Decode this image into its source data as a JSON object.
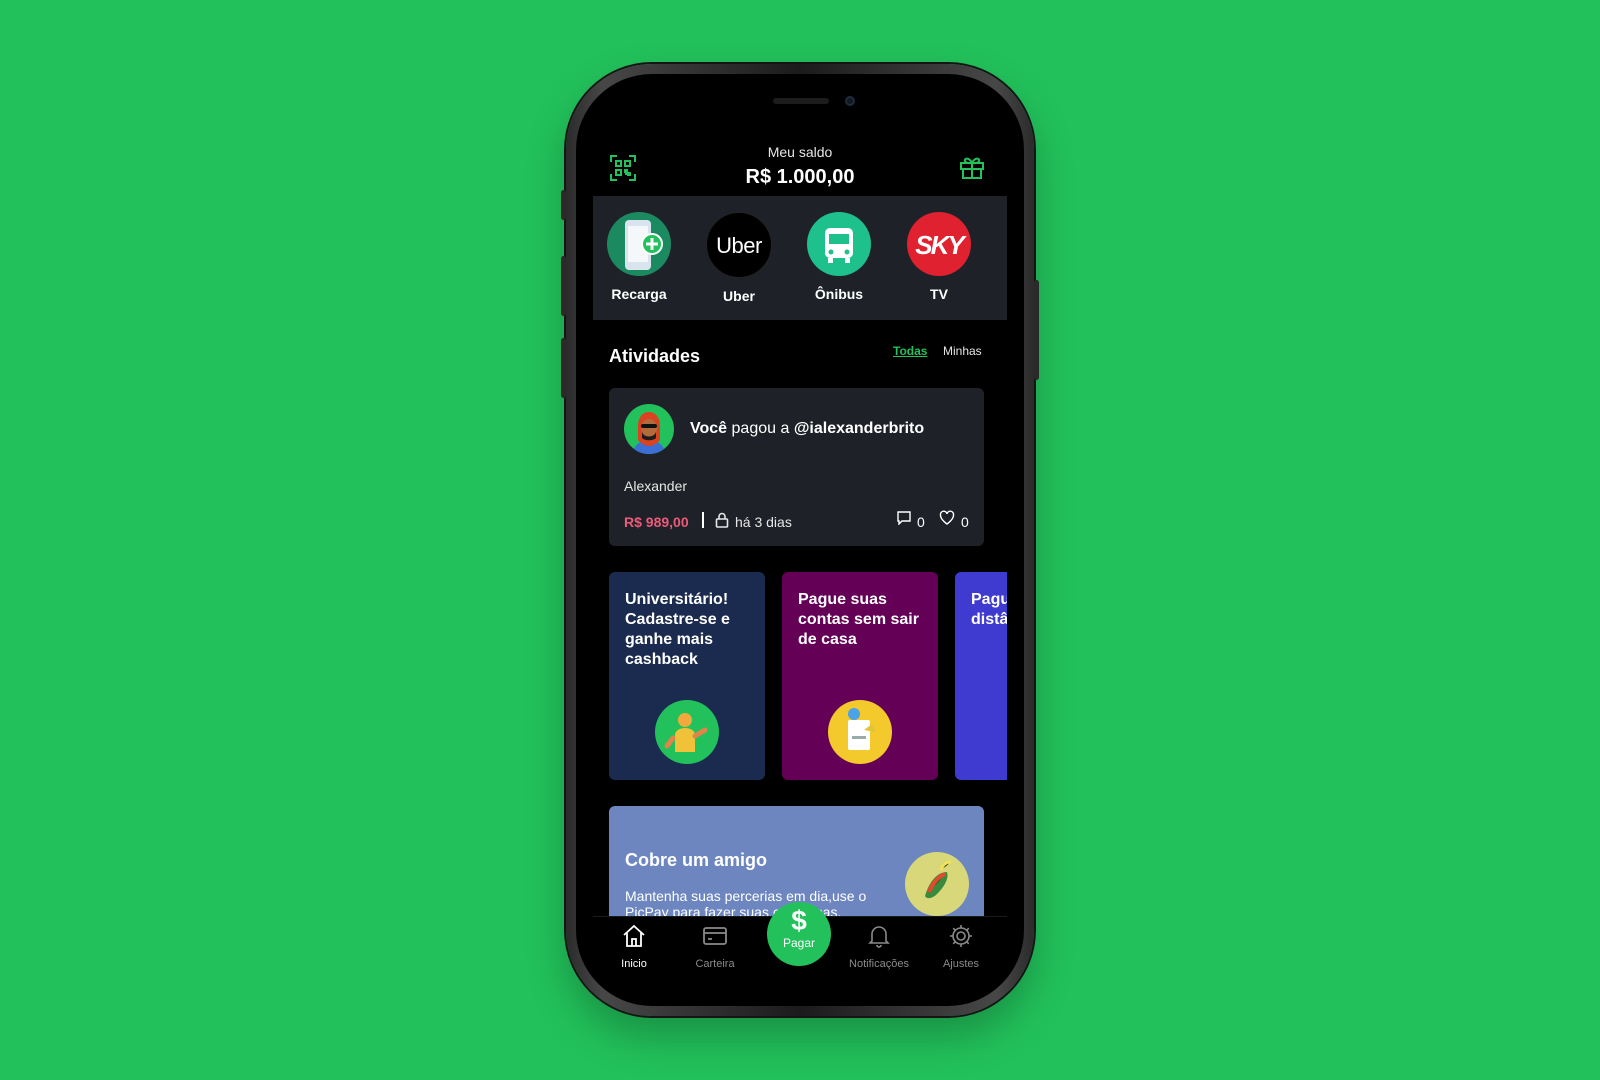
{
  "header": {
    "balance_label": "Meu saldo",
    "balance_value": "R$ 1.000,00"
  },
  "shortcuts": [
    {
      "label": "Recarga",
      "icon": "phone-recharge-icon",
      "color": "#1c8a61"
    },
    {
      "label": "Uber",
      "icon": "uber-logo",
      "logo_text": "Uber",
      "color": "#000000"
    },
    {
      "label": "Ônibus",
      "icon": "bus-icon",
      "color": "#1ec08c"
    },
    {
      "label": "TV",
      "icon": "sky-logo",
      "logo_text": "SKY",
      "color": "#e0212f"
    }
  ],
  "activities": {
    "title": "Atividades",
    "filters": {
      "all": "Todas",
      "mine": "Minhas"
    },
    "items": [
      {
        "actor": "Você",
        "verb": "pagou a",
        "target": "@ialexanderbrito",
        "name": "Alexander",
        "amount": "R$ 989,00",
        "time": "há 3 dias",
        "comments": "0",
        "likes": "0"
      }
    ]
  },
  "promos": [
    {
      "text": "Universitário! Cadastre-se e ganhe mais cashback",
      "color": "#1b2b4f"
    },
    {
      "text": "Pague suas contas sem sair de casa",
      "color": "#650057"
    },
    {
      "text": "Pague amigos a distância",
      "color": "#3f3ad0"
    }
  ],
  "cobre": {
    "title": "Cobre um amigo",
    "description": "Mantenha suas percerias em dia,use o PicPay para fazer suas cobranças."
  },
  "tabbar": {
    "items": [
      {
        "label": "Inicio",
        "icon": "home-icon",
        "active": true
      },
      {
        "label": "Carteira",
        "icon": "wallet-icon"
      },
      {
        "label": "Pagar",
        "icon": "dollar-icon"
      },
      {
        "label": "Notificações",
        "icon": "bell-icon"
      },
      {
        "label": "Ajustes",
        "icon": "gear-icon"
      }
    ]
  },
  "colors": {
    "background": "#22c15b",
    "accent": "#22c15b",
    "amount": "#ec5a7a",
    "card": "#1e2228"
  }
}
